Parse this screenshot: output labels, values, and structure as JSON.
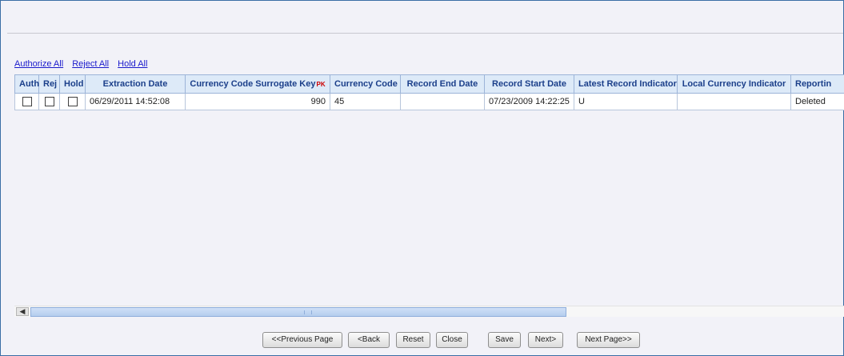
{
  "actions": {
    "authorize_all": "Authorize All",
    "reject_all": "Reject All",
    "hold_all": "Hold All"
  },
  "grid": {
    "columns": [
      "Auth",
      "Rej",
      "Hold",
      "Extraction Date",
      "Currency Code Surrogate Key",
      "Currency Code",
      "Record End Date",
      "Record Start Date",
      "Latest Record Indicator",
      "Local Currency Indicator",
      "Reportin"
    ],
    "pk_marker": "PK",
    "row": {
      "extraction_date": "06/29/2011 14:52:08",
      "surrogate_key": "990",
      "currency_code": "45",
      "record_end_date": "",
      "record_start_date": "07/23/2009 14:22:25",
      "latest_record_indicator": "U",
      "local_currency_indicator": "",
      "reporting": "Deleted"
    }
  },
  "buttons": {
    "previous_page": "<<Previous Page",
    "back": "<Back",
    "reset": "Reset",
    "close": "Close",
    "save": "Save",
    "next": "Next>",
    "next_page": "Next Page>>"
  },
  "scrollbar": {
    "left_arrow_glyph": "◀"
  },
  "colors": {
    "header_bg": "#ddeaf8",
    "header_text": "#1b3f8a",
    "link": "#1a1acc",
    "pk": "#cc0000"
  }
}
